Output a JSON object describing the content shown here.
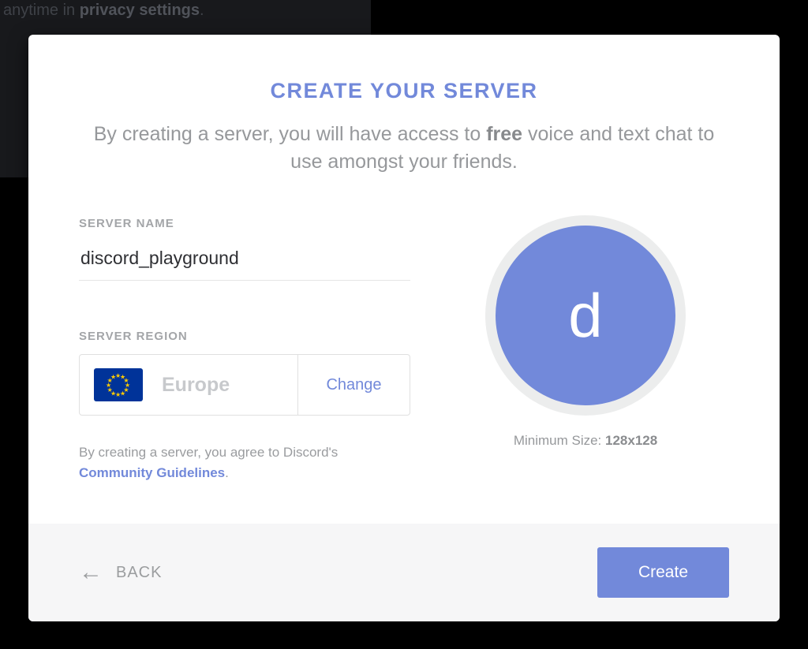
{
  "backdrop": {
    "line_prefix": "anytime in ",
    "privacy_link": "privacy settings",
    "line_suffix": "."
  },
  "modal": {
    "title": "CREATE YOUR SERVER",
    "subtitle_pre": "By creating a server, you will have access to ",
    "subtitle_strong": "free",
    "subtitle_post": " voice and text chat to use amongst your friends.",
    "server_name_label": "SERVER NAME",
    "server_name_value": "discord_playground",
    "server_region_label": "SERVER REGION",
    "region_name": "Europe",
    "change_label": "Change",
    "terms_pre": "By creating a server, you agree to Discord's ",
    "terms_link": "Community Guidelines",
    "terms_post": ".",
    "avatar_letter": "d",
    "min_size_pre": "Minimum Size: ",
    "min_size_value": "128x128",
    "back_label": "BACK",
    "create_label": "Create"
  }
}
